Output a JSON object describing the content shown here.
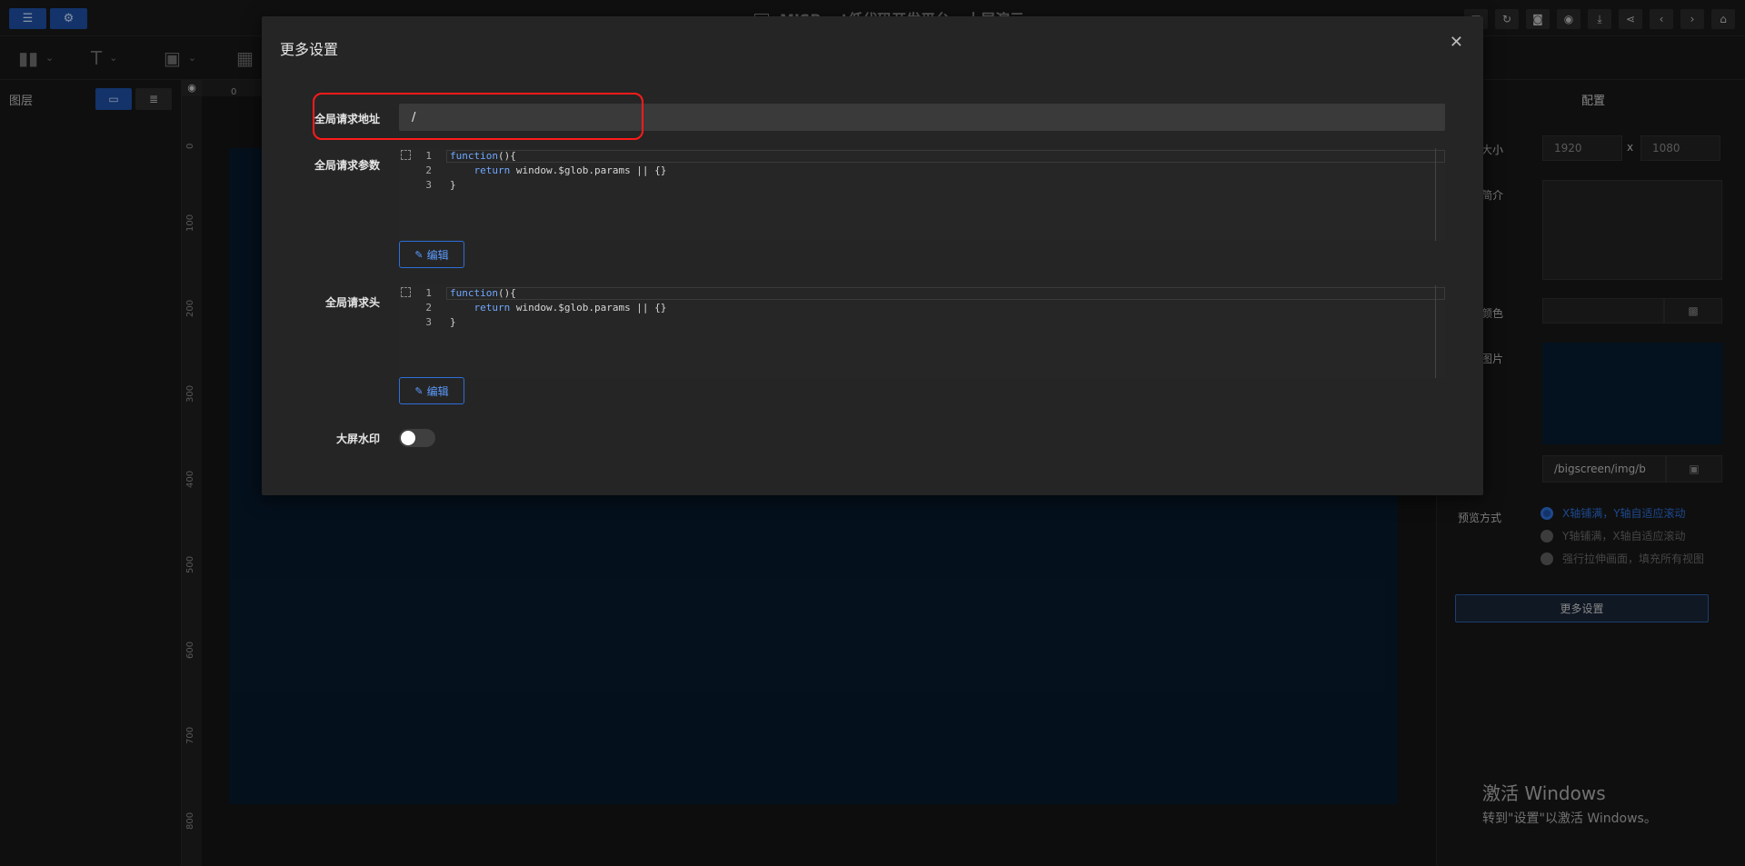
{
  "app": {
    "title": "MISBoot低代码开发平台 - 大屏演示"
  },
  "topbar": {
    "left_buttons": [
      "sliders-icon",
      "settings-icon"
    ]
  },
  "toolbar": {
    "tools": [
      "bar-chart-icon",
      "text-icon",
      "image-icon",
      "grid-icon"
    ]
  },
  "left_panel": {
    "title": "图层",
    "view_buttons": [
      "monitor-icon",
      "database-icon"
    ]
  },
  "ruler": {
    "zero": "0",
    "ticks": [
      "0",
      "100",
      "200",
      "300",
      "400",
      "500",
      "600",
      "700",
      "800"
    ]
  },
  "right_panel": {
    "tab": "配置",
    "size_label": "大小",
    "width": "1920",
    "x": "x",
    "height": "1080",
    "intro_label": "简介",
    "color_label": "颜色",
    "image_label": "图片",
    "image_path": "/bigscreen/img/b",
    "preview_label": "预览方式",
    "preview_options": [
      "X轴铺满，Y轴自适应滚动",
      "Y轴铺满，X轴自适应滚动",
      "强行拉伸画面，填充所有视图"
    ],
    "preview_selected": 0,
    "more_button": "更多设置"
  },
  "windows_watermark": {
    "line1": "激活 Windows",
    "line2": "转到\"设置\"以激活 Windows。"
  },
  "modal": {
    "title": "更多设置",
    "url_label": "全局请求地址",
    "url_value": "/",
    "params_label": "全局请求参数",
    "headers_label": "全局请求头",
    "code_lines": [
      {
        "n": "1",
        "kw": "function",
        "rest": "(){"
      },
      {
        "n": "2",
        "kw": "    return",
        "rest": " window.$glob.params || {}"
      },
      {
        "n": "3",
        "kw": "",
        "rest": "}"
      }
    ],
    "edit_button": "编辑",
    "watermark_label": "大屏水印",
    "watermark_enabled": false
  },
  "colors": {
    "accent": "#1e4fa3",
    "highlight": "#ff1a1a",
    "screen_bg": "#071a2b"
  }
}
